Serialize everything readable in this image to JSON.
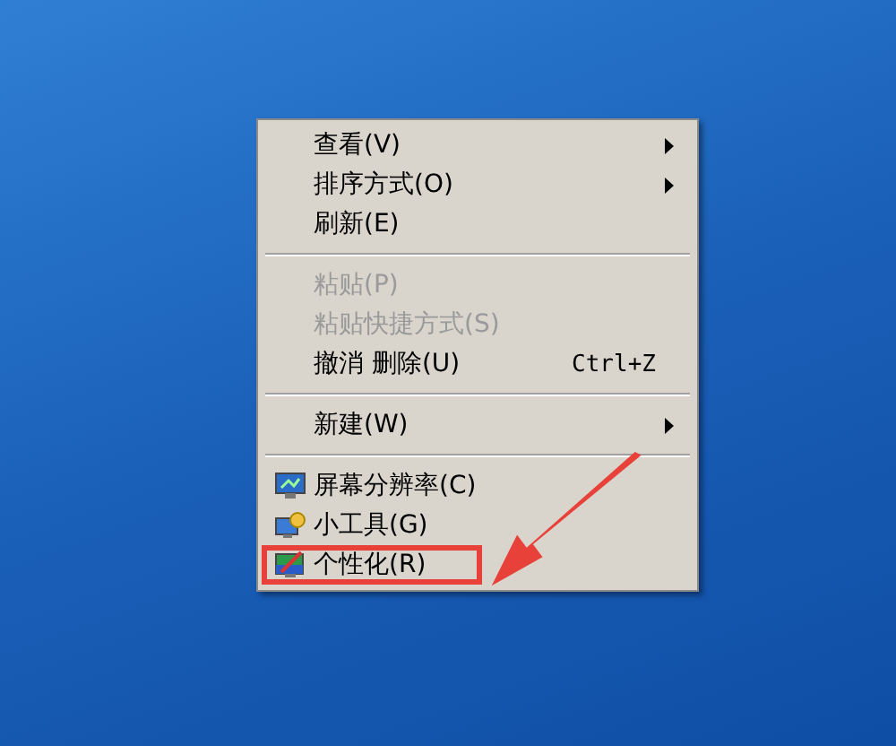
{
  "context_menu": {
    "sections": [
      [
        {
          "label": "查看(V)",
          "disabled": false,
          "submenu": true,
          "highlighted": false
        },
        {
          "label": "排序方式(O)",
          "disabled": false,
          "submenu": true,
          "highlighted": false
        },
        {
          "label": "刷新(E)",
          "disabled": false,
          "submenu": false,
          "highlighted": false
        }
      ],
      [
        {
          "label": "粘贴(P)",
          "disabled": true,
          "submenu": false,
          "highlighted": false
        },
        {
          "label": "粘贴快捷方式(S)",
          "disabled": true,
          "submenu": false,
          "highlighted": false
        },
        {
          "label": "撤消 删除(U)",
          "disabled": false,
          "submenu": false,
          "shortcut": "Ctrl+Z",
          "highlighted": false
        }
      ],
      [
        {
          "label": "新建(W)",
          "disabled": false,
          "submenu": true,
          "highlighted": false
        }
      ],
      [
        {
          "label": "屏幕分辨率(C)",
          "disabled": false,
          "submenu": false,
          "kind": "monitor",
          "highlighted": false
        },
        {
          "label": "小工具(G)",
          "disabled": false,
          "submenu": false,
          "kind": "gadgets",
          "highlighted": false
        },
        {
          "label": "个性化(R)",
          "disabled": false,
          "submenu": false,
          "kind": "personalize",
          "highlighted": true
        }
      ]
    ]
  }
}
